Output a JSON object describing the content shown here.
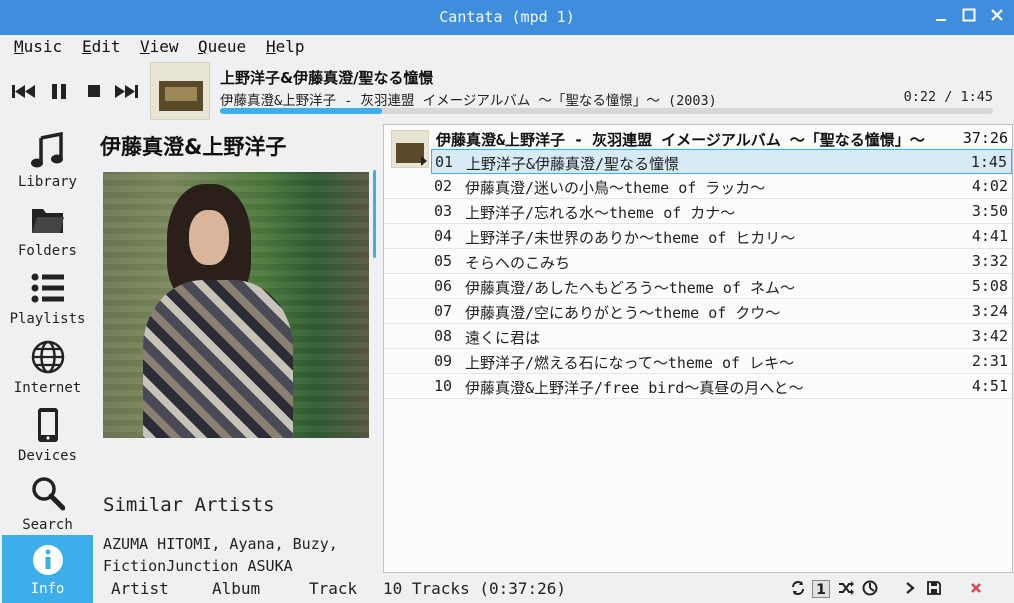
{
  "window": {
    "title": "Cantata (mpd 1)"
  },
  "menu": [
    "Music",
    "Edit",
    "View",
    "Queue",
    "Help"
  ],
  "now_playing": {
    "title": "上野洋子&伊藤真澄/聖なる憧憬",
    "subtitle": "伊藤真澄&上野洋子 - 灰羽連盟 イメージアルバム 〜「聖なる憧憬」〜 (2003)",
    "time": "0:22 / 1:45",
    "progress": 0.21
  },
  "sidebar": [
    {
      "label": "Library",
      "icon": "music-note-icon"
    },
    {
      "label": "Folders",
      "icon": "folder-icon"
    },
    {
      "label": "Playlists",
      "icon": "list-icon"
    },
    {
      "label": "Internet",
      "icon": "globe-icon"
    },
    {
      "label": "Devices",
      "icon": "phone-icon"
    },
    {
      "label": "Search",
      "icon": "search-icon"
    },
    {
      "label": "Info",
      "icon": "info-icon"
    }
  ],
  "info": {
    "artist": "伊藤真澄&上野洋子",
    "similar_heading": "Similar Artists",
    "similar_text": "AZUMA HITOMI, Ayana, Buzy,",
    "similar_text2": "FictionJunction ASUKA"
  },
  "playlist": {
    "album_header": "伊藤真澄&上野洋子 - 灰羽連盟 イメージアルバム 〜「聖なる憧憬」〜",
    "album_duration": "37:26",
    "tracks": [
      {
        "num": "01",
        "title": "上野洋子&伊藤真澄/聖なる憧憬",
        "duration": "1:45"
      },
      {
        "num": "02",
        "title": "伊藤真澄/迷いの小鳥〜theme of ラッカ〜",
        "duration": "4:02"
      },
      {
        "num": "03",
        "title": "上野洋子/忘れる水〜theme of カナ〜",
        "duration": "3:50"
      },
      {
        "num": "04",
        "title": "上野洋子/未世界のありか〜theme of ヒカリ〜",
        "duration": "4:41"
      },
      {
        "num": "05",
        "title": "そらへのこみち",
        "duration": "3:32"
      },
      {
        "num": "06",
        "title": "伊藤真澄/あしたへもどろう〜theme of ネム〜",
        "duration": "5:08"
      },
      {
        "num": "07",
        "title": "伊藤真澄/空にありがとう〜theme of クウ〜",
        "duration": "3:24"
      },
      {
        "num": "08",
        "title": "遠くに君は",
        "duration": "3:42"
      },
      {
        "num": "09",
        "title": "上野洋子/燃える石になって〜theme of レキ〜",
        "duration": "2:31"
      },
      {
        "num": "10",
        "title": "伊藤真澄&上野洋子/free bird〜真昼の月へと〜",
        "duration": "4:51"
      }
    ]
  },
  "status": {
    "tabs": [
      "Artist",
      "Album",
      "Track"
    ],
    "summary": "10 Tracks (0:37:26)",
    "single_label": "1"
  },
  "colors": {
    "titlebar": "#3e8edd",
    "accent": "#3daee9",
    "remove": "#da4453"
  }
}
